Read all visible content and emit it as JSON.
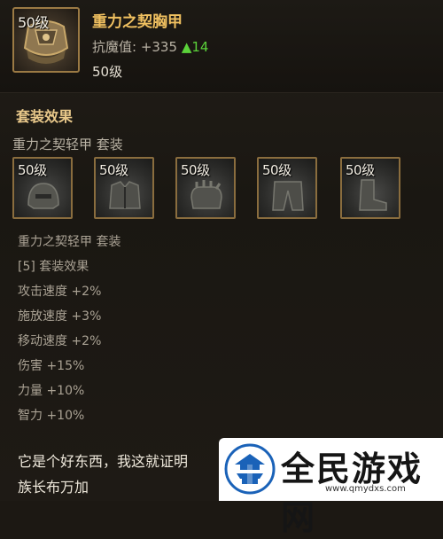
{
  "item": {
    "level_badge": "50级",
    "name": "重力之契胸甲",
    "stat_label": "抗魔值: +335",
    "stat_delta": "▲14",
    "required_level": "50级"
  },
  "set_section": {
    "title": "套装效果",
    "set_name": "重力之契轻甲 套装",
    "slots": [
      {
        "level_badge": "50级",
        "icon": "helmet-icon"
      },
      {
        "level_badge": "50级",
        "icon": "chest-armor-icon"
      },
      {
        "level_badge": "50级",
        "icon": "gloves-icon"
      },
      {
        "level_badge": "50级",
        "icon": "leggings-icon"
      },
      {
        "level_badge": "50级",
        "icon": "boots-icon"
      }
    ],
    "lines": [
      "重力之契轻甲 套装",
      "[5] 套装效果",
      "攻击速度 +2%",
      "施放速度 +3%",
      "移动速度 +2%",
      "伤害 +15%",
      "力量 +10%",
      "智力 +10%"
    ]
  },
  "description": {
    "line1": "它是个好东西，我这就证明",
    "line2": "族长布万加"
  },
  "watermark": {
    "title": "全民游戏网",
    "url": "www.qmydxs.com"
  },
  "colors": {
    "item_name": "#f0c060",
    "stat_delta": "#5bd23a",
    "section_title": "#e8c88a",
    "slot_border": "#8a6d3e"
  }
}
